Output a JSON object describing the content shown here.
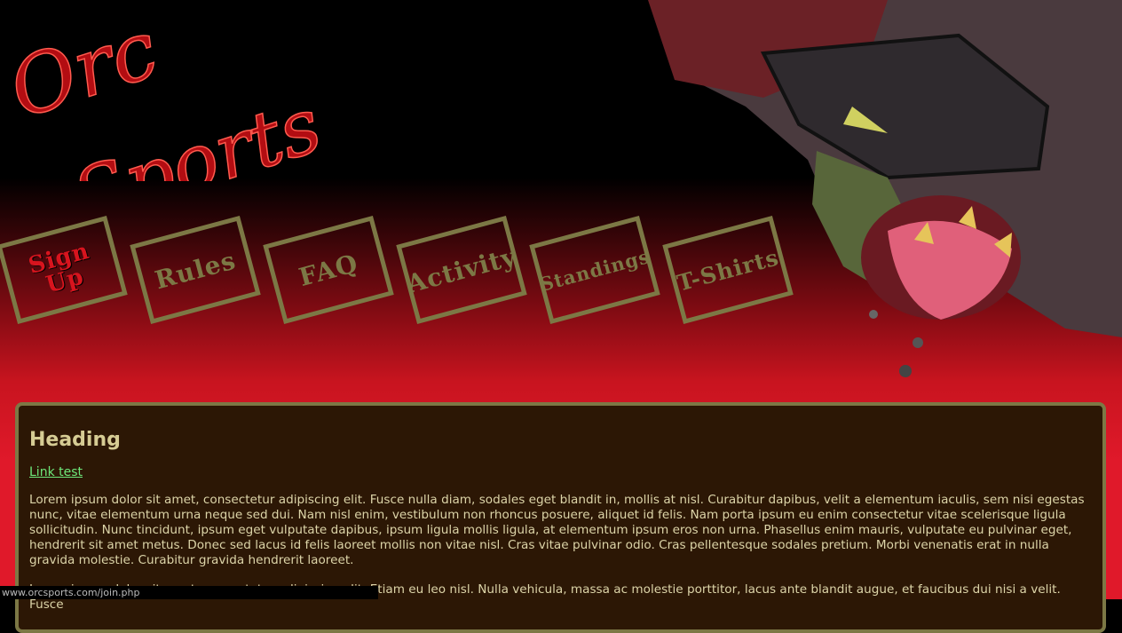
{
  "logo": {
    "line1": "Orc",
    "line2": "Sports"
  },
  "nav": {
    "items": [
      {
        "label": "Sign\n  Up"
      },
      {
        "label": "Rules"
      },
      {
        "label": "FAQ"
      },
      {
        "label": "Activity"
      },
      {
        "label": "Standings"
      },
      {
        "label": "T-Shirts"
      }
    ]
  },
  "content": {
    "heading": "Heading",
    "link": "Link test",
    "paragraph1": "Lorem ipsum dolor sit amet, consectetur adipiscing elit. Fusce nulla diam, sodales eget blandit in, mollis at nisl. Curabitur dapibus, velit a elementum iaculis, sem nisi egestas nunc, vitae elementum urna neque sed dui. Nam nisl enim, vestibulum non rhoncus posuere, aliquet id felis. Nam porta ipsum eu enim consectetur vitae scelerisque ligula sollicitudin. Nunc tincidunt, ipsum eget vulputate dapibus, ipsum ligula mollis ligula, at elementum ipsum eros non urna. Phasellus enim mauris, vulputate eu pulvinar eget, hendrerit sit amet metus. Donec sed lacus id felis laoreet mollis non vitae nisl. Cras vitae pulvinar odio. Cras pellentesque sodales pretium. Morbi venenatis erat in nulla gravida molestie. Curabitur gravida hendrerit laoreet.",
    "paragraph2": "Lorem ipsum dolor sit amet, consectetur adipiscing elit. Etiam eu leo nisl. Nulla vehicula, massa ac molestie porttitor, lacus ante blandit augue, et faucibus dui nisi a velit. Fusce"
  },
  "status_bar": {
    "url": "www.orcsports.com/join.php"
  },
  "colors": {
    "accent": "#7c7845",
    "red": "#d8141e",
    "panel": "#2c1705",
    "link": "#6ee87a"
  }
}
